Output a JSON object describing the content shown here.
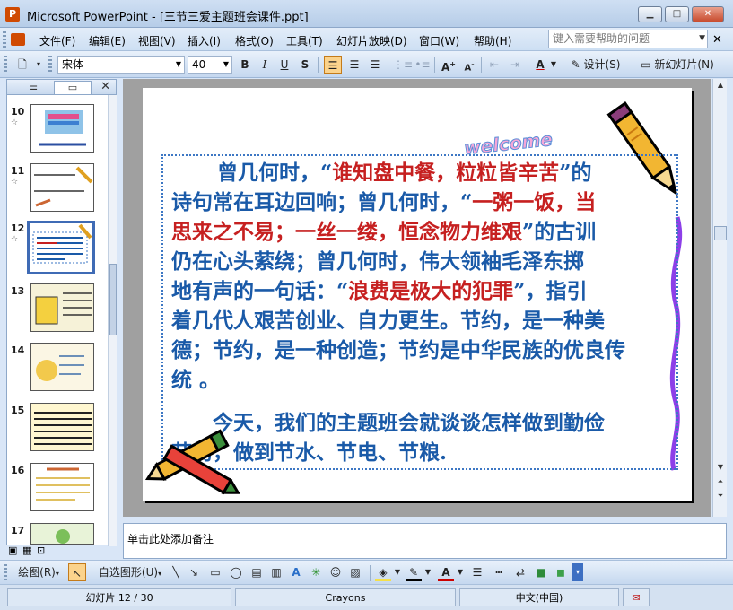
{
  "window": {
    "title": "Microsoft PowerPoint - [三节三爱主题班会课件.ppt]"
  },
  "menu": {
    "items": [
      "文件(F)",
      "编辑(E)",
      "视图(V)",
      "插入(I)",
      "格式(O)",
      "工具(T)",
      "幻灯片放映(D)",
      "窗口(W)",
      "帮助(H)"
    ],
    "help_placeholder": "键入需要帮助的问题"
  },
  "toolbar": {
    "font_name": "宋体",
    "font_size": "40",
    "bold": "B",
    "italic": "I",
    "underline": "U",
    "shadow": "S",
    "design_label": "设计(S)",
    "new_slide_label": "新幻灯片(N)"
  },
  "slides_pane": {
    "thumbnails": [
      {
        "number": "10",
        "star": "☆"
      },
      {
        "number": "11",
        "star": "☆"
      },
      {
        "number": "12",
        "star": "☆"
      },
      {
        "number": "13",
        "star": ""
      },
      {
        "number": "14",
        "star": ""
      },
      {
        "number": "15",
        "star": ""
      },
      {
        "number": "16",
        "star": ""
      },
      {
        "number": "17",
        "star": ""
      }
    ],
    "selected": "12"
  },
  "slide": {
    "welcome": "welcome",
    "p1_l1_a": "曾几何时，“",
    "p1_l1_b": "谁知盘中餐，粒粒皆辛苦",
    "p1_l1_c": "”的",
    "p1_l2_a": "诗句常在耳边回响；曾几何时，“",
    "p1_l2_b": "一粥一饭，当",
    "p1_l3_a": "思来之不易；一丝一缕，恒念物力维艰",
    "p1_l3_b": "”的古训",
    "p1_l4": "仍在心头萦绕；曾几何时，伟大领袖毛泽东掷",
    "p1_l5_a": "地有声的一句话：“",
    "p1_l5_b": "浪费是极大的犯罪",
    "p1_l5_c": "”，指引",
    "p1_l6": "着几代人艰苦创业、自力更生。节约，是一种美",
    "p1_l7": "德；节约，是一种创造；节约是中华民族的优良传",
    "p1_l8": "统 。",
    "p2_l1": "今天，我们的主题班会就谈谈怎样做到勤俭",
    "p2_l2": "节约，做到节水、节电、节粮."
  },
  "notes": {
    "placeholder": "单击此处添加备注"
  },
  "draw_toolbar": {
    "draw_label": "绘图(R)",
    "autoshapes_label": "自选图形(U)"
  },
  "status": {
    "slide_of": "幻灯片 12 / 30",
    "theme": "Crayons",
    "language": "中文(中国)"
  },
  "colors": {
    "accent": "#1a5aa8",
    "highlight": "#c62020",
    "chrome": "#d9e6f7"
  }
}
